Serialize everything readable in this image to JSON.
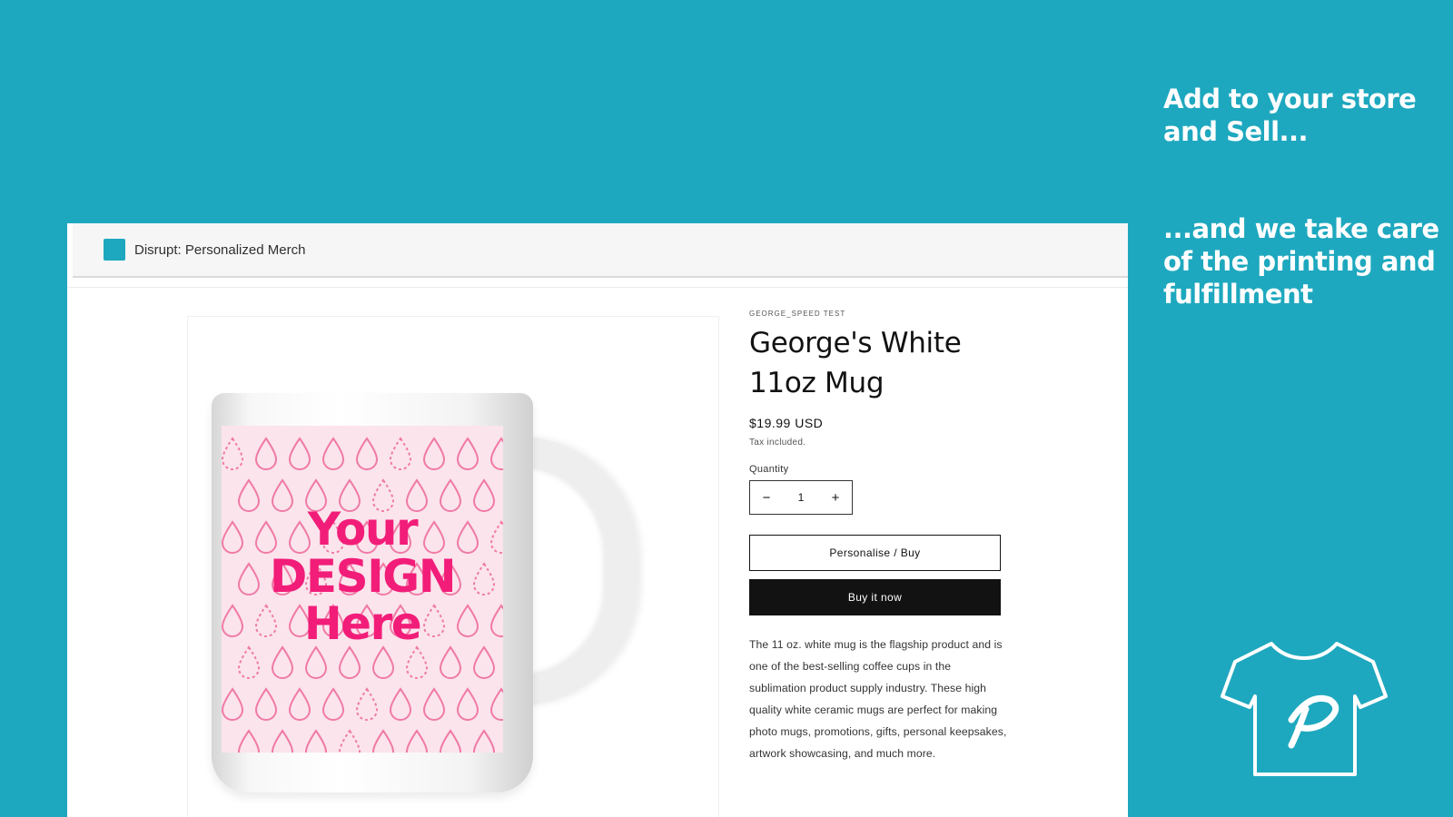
{
  "promo": {
    "tagline_1": [
      "Add to your store",
      "and Sell..."
    ],
    "tagline_2": [
      "...and we take care",
      "of the printing and",
      "fulfillment"
    ]
  },
  "app": {
    "title": "Disrupt: Personalized Merch",
    "accent_color": "#1ea8bf"
  },
  "product": {
    "vendor": "GEORGE_SPEED TEST",
    "title": "George's White 11oz Mug",
    "price": "$19.99 USD",
    "tax_note": "Tax included.",
    "quantity_label": "Quantity",
    "quantity_value": "1",
    "decrement_symbol": "−",
    "increment_symbol": "+",
    "personalise_label": "Personalise / Buy",
    "buy_now_label": "Buy it now",
    "description": "The 11 oz. white mug is the flagship product and is one of the best-selling coffee cups in the sublimation product supply industry. These high quality white ceramic mugs are perfect for making photo mugs, promotions, gifts, personal keepsakes, artwork showcasing, and much more.",
    "image": {
      "design_text": [
        "Your",
        "DESIGN",
        "Here"
      ],
      "design_color": "#f21d79"
    }
  },
  "icons": {
    "brand_logo": "tshirt-p-logo-icon"
  }
}
